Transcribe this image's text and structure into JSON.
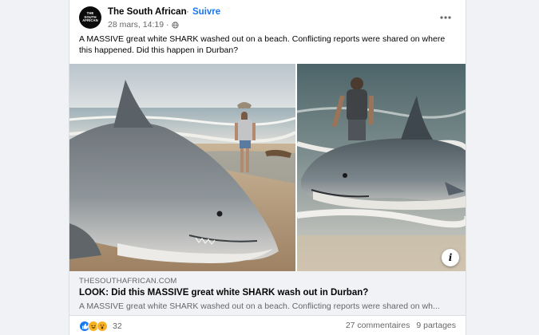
{
  "post": {
    "page_name": "The South African",
    "separator": "·",
    "follow_label": "Suivre",
    "avatar_text": [
      "THE",
      "SOUTH",
      "AFRICAN"
    ],
    "date": "28 mars, 14:19",
    "date_separator": "·",
    "privacy_icon": "globe-icon",
    "more_icon": "more-horizontal-icon",
    "caption": "A MASSIVE great white SHARK washed out on a beach. Conflicting reports were shared on where this happened. Did this happen in Durban?",
    "info_icon": "i"
  },
  "link_preview": {
    "domain": "THESOUTHAFRICAN.COM",
    "title": "LOOK: Did this MASSIVE great white SHARK wash out in Durban?",
    "description": "A MASSIVE great white SHARK washed out on a beach. Conflicting reports were shared on wh..."
  },
  "footer": {
    "reactions": [
      "like-reaction-icon",
      "haha-reaction-icon",
      "wow-reaction-icon"
    ],
    "reaction_count": "32",
    "comments": "27 commentaires",
    "shares": "9 partages"
  },
  "colors": {
    "accent": "#1877f2",
    "secondary_text": "#65676b",
    "primary_text": "#050505",
    "link_bg": "#f0f2f5"
  }
}
